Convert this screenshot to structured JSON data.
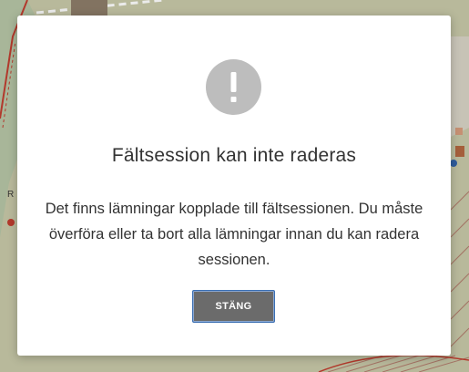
{
  "dialog": {
    "icon": "exclamation-icon",
    "title": "Fältsession kan inte raderas",
    "message": "Det finns lämningar kopplade till fältsessionen. Du måste överföra eller ta bort alla lämningar innan du kan radera sessionen.",
    "close_label": "STÄNG"
  },
  "map": {
    "markers": {
      "left_letter": "R"
    }
  },
  "colors": {
    "map_background": "#c7c8a6",
    "icon_circle": "#bdbdbd",
    "button_background": "#6b6b6b",
    "button_border": "#3c6fb3",
    "map_road_red": "#c0392b"
  }
}
